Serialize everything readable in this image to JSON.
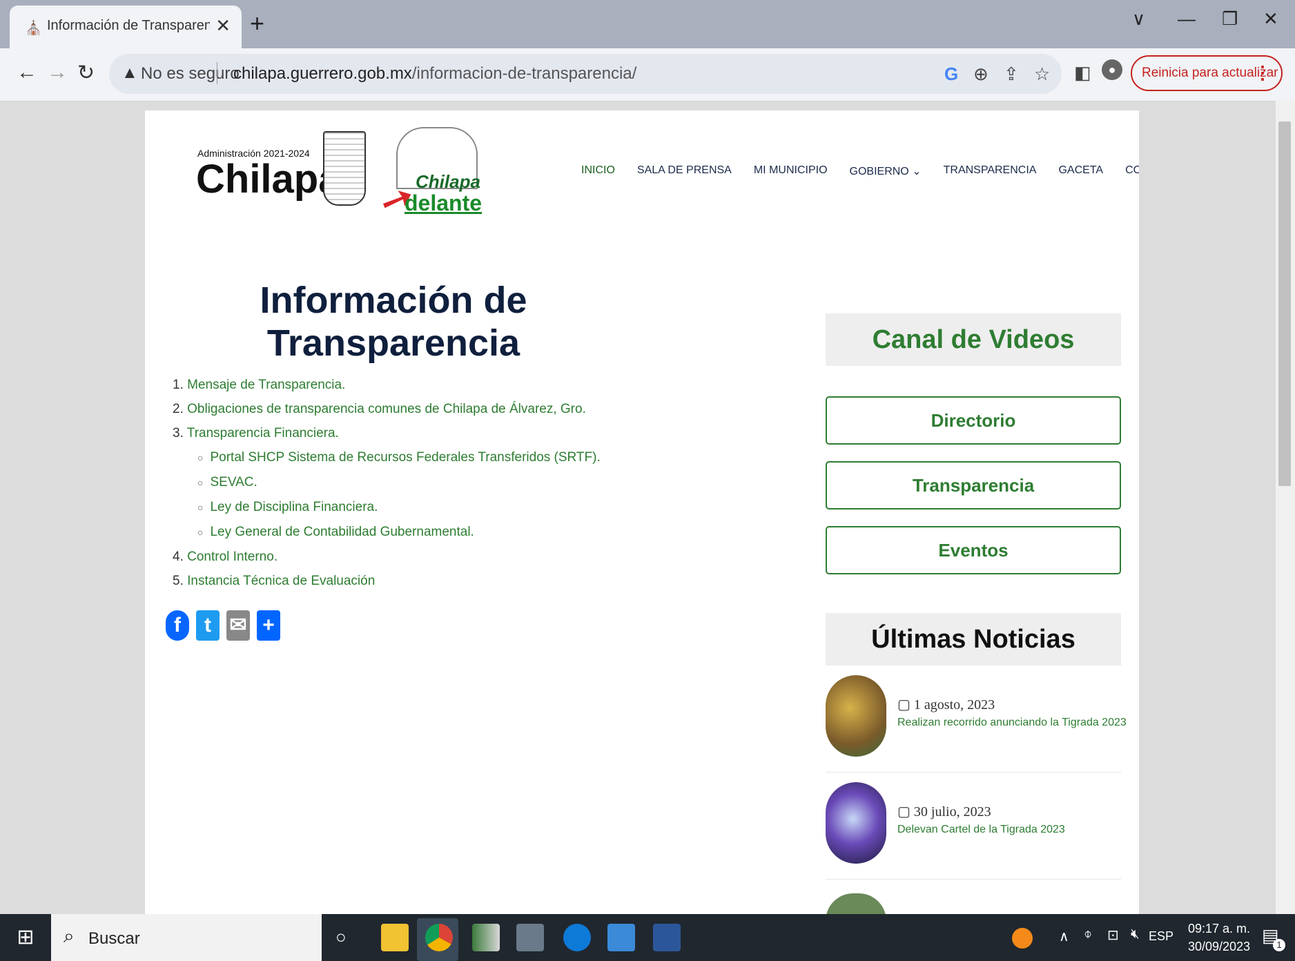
{
  "browser": {
    "tab_title": "Información de Transparencia | H",
    "tab_close": "✕",
    "new_tab": "+",
    "security_label": "No es seguro",
    "url_host": "chilapa.guerrero.gob.mx",
    "url_path": "/informacion-de-transparencia/",
    "relaunch_label": "Reinicia para actualizar",
    "window_controls": [
      "∨",
      "—",
      "❐",
      "✕"
    ]
  },
  "header": {
    "admin_label": "Administración 2021-2024",
    "logo_name": "Chilapa",
    "logo2_top": "Chilapa",
    "logo2_bottom": "delante",
    "nav": [
      "INICIO",
      "SALA DE PRENSA",
      "MI MUNICIPIO",
      "GOBIERNO ⌄",
      "TRANSPARENCIA",
      "GACETA",
      "CONTACTO"
    ]
  },
  "main": {
    "title": "Información de Transparencia",
    "items": [
      {
        "num": "1.",
        "text": "Mensaje de Transparencia."
      },
      {
        "num": "2.",
        "text": "Obligaciones de transparencia comunes de Chilapa de Álvarez, Gro."
      },
      {
        "num": "3.",
        "text": "Transparencia Financiera."
      },
      {
        "num": "4.",
        "text": "Control Interno."
      },
      {
        "num": "5.",
        "text": "Instancia Técnica de Evaluación"
      }
    ],
    "subitems": [
      "Portal SHCP Sistema de Recursos Federales Transferidos (SRTF).",
      "SEVAC.",
      "Ley de Disciplina Financiera.",
      "Ley General de Contabilidad Gubernamental."
    ],
    "share": [
      "f",
      "t",
      "✉",
      "+"
    ]
  },
  "sidebar": {
    "canal_title": "Canal de Videos",
    "buttons": [
      "Directorio",
      "Transparencia",
      "Eventos"
    ],
    "news_title": "Últimas Noticias",
    "news": [
      {
        "date": "1 agosto, 2023",
        "title": "Realizan recorrido anunciando la Tigrada 2023"
      },
      {
        "date": "30 julio, 2023",
        "title": "Delevan Cartel de la Tigrada 2023"
      }
    ]
  },
  "taskbar": {
    "search_label": "Buscar",
    "language": "ESP",
    "time": "09:17 a. m.",
    "date": "30/09/2023",
    "notification_count": "1"
  },
  "colors": {
    "accent_green": "#2e7d32",
    "title_navy": "#0f1f3d",
    "relaunch_red": "#c5221f"
  }
}
